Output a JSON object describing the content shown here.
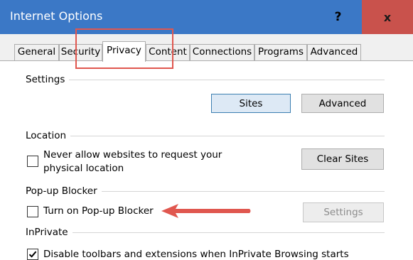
{
  "window": {
    "title": "Internet Options",
    "help_glyph": "?",
    "close_glyph": "x"
  },
  "tabs": [
    {
      "label": "General"
    },
    {
      "label": "Security"
    },
    {
      "label": "Privacy",
      "selected": true
    },
    {
      "label": "Content"
    },
    {
      "label": "Connections"
    },
    {
      "label": "Programs"
    },
    {
      "label": "Advanced"
    }
  ],
  "settings": {
    "label": "Settings",
    "sites_button": "Sites",
    "advanced_button": "Advanced"
  },
  "location": {
    "label": "Location",
    "checkbox_line1": "Never allow websites to request your",
    "checkbox_line2": "physical location",
    "checked": false,
    "clear_sites_button": "Clear Sites"
  },
  "popup": {
    "label": "Pop-up Blocker",
    "checkbox_label": "Turn on Pop-up Blocker",
    "checked": false,
    "settings_button": "Settings"
  },
  "inprivate": {
    "label": "InPrivate",
    "checkbox_label": "Disable toolbars and extensions when InPrivate Browsing starts",
    "checked": true
  },
  "colors": {
    "titlebar": "#3b78c6",
    "close_button": "#c9524c",
    "annotation": "#e0574f"
  }
}
